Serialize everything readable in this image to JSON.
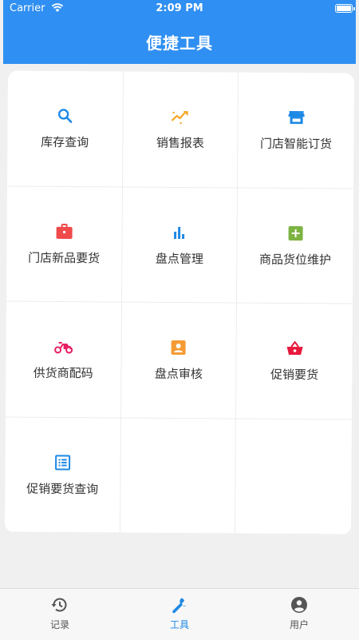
{
  "status_bar": {
    "carrier": "Carrier",
    "time": "2:09 PM"
  },
  "header": {
    "title": "便捷工具"
  },
  "tools": [
    {
      "label": "库存查询",
      "icon": "search-icon",
      "color": "#1e88e5"
    },
    {
      "label": "销售报表",
      "icon": "trending-icon",
      "color": "#f5a623"
    },
    {
      "label": "门店智能订货",
      "icon": "store-icon",
      "color": "#1e88e5"
    },
    {
      "label": "门店新品要货",
      "icon": "briefcase-icon",
      "color": "#f04a4a"
    },
    {
      "label": "盘点管理",
      "icon": "bar-chart-icon",
      "color": "#1e88e5"
    },
    {
      "label": "商品货位维护",
      "icon": "add-box-icon",
      "color": "#7cb342"
    },
    {
      "label": "供货商配码",
      "icon": "motorcycle-icon",
      "color": "#e91e63"
    },
    {
      "label": "盘点审核",
      "icon": "contact-card-icon",
      "color": "#f59b35"
    },
    {
      "label": "促销要货",
      "icon": "basket-icon",
      "color": "#e8193c"
    },
    {
      "label": "促销要货查询",
      "icon": "list-alt-icon",
      "color": "#1e88e5"
    }
  ],
  "tabbar": {
    "items": [
      {
        "label": "记录",
        "icon": "history-icon"
      },
      {
        "label": "工具",
        "icon": "wrench-icon",
        "active": true
      },
      {
        "label": "用户",
        "icon": "account-icon"
      }
    ],
    "active_color": "#1e88e5",
    "inactive_color": "#555555"
  },
  "colors": {
    "header_bg": "#2f8ff2",
    "page_bg": "#f0f0f0"
  }
}
